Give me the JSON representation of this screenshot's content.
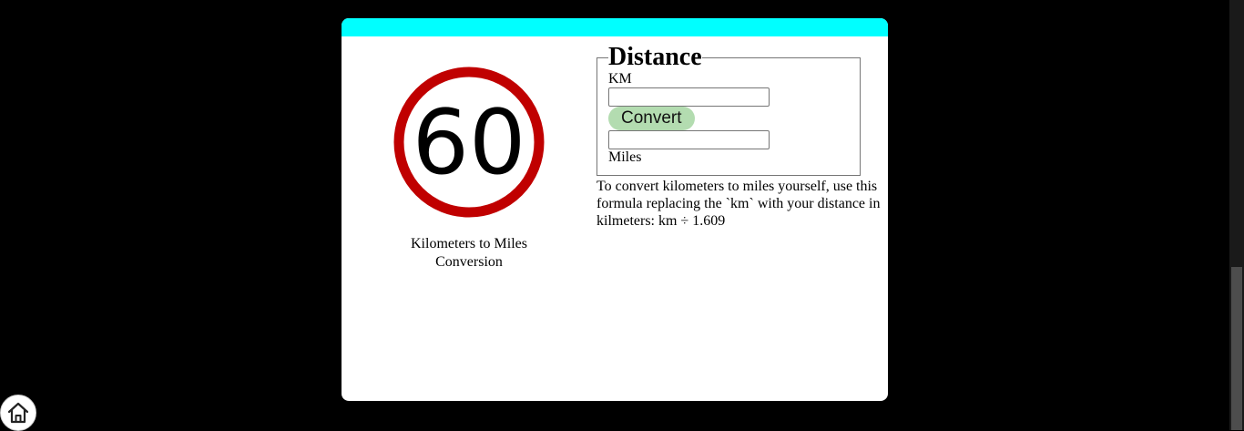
{
  "colors": {
    "page_background": "#000000",
    "card_background": "#ffffff",
    "card_topbar": "#00ffff",
    "sign_ring": "#c00000",
    "convert_button": "#b3dcb0"
  },
  "sign": {
    "number": "60"
  },
  "caption": "Kilometers to Miles Conversion",
  "form": {
    "legend": "Distance",
    "km_label": "KM",
    "km_value": "",
    "convert_label": "Convert",
    "miles_value": "",
    "miles_label": "Miles"
  },
  "help_text": "To convert kilometers to miles yourself, use this formula replacing the `km` with your distance in kilmeters: km ÷ 1.609",
  "icons": {
    "home": "home-icon"
  }
}
